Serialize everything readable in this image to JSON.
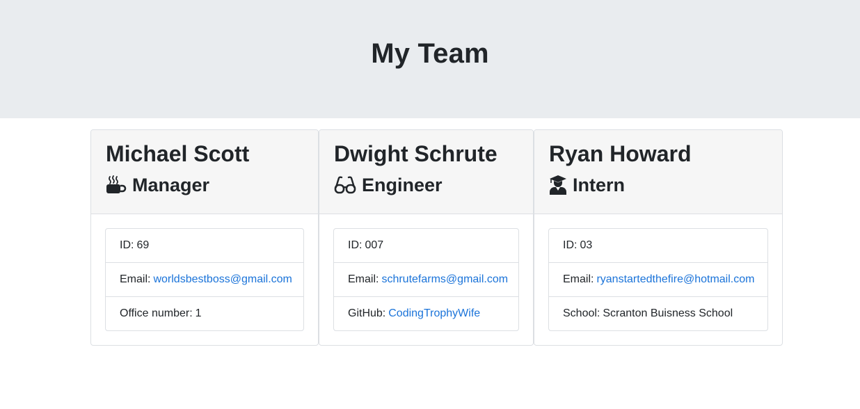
{
  "header": {
    "title": "My Team"
  },
  "employees": [
    {
      "name": "Michael Scott",
      "role": "Manager",
      "role_icon": "coffee-mug-icon",
      "id_label": "ID:",
      "id": "69",
      "email_label": "Email:",
      "email": "worldsbestboss@gmail.com",
      "extra_label": "Office number:",
      "extra_value": "1"
    },
    {
      "name": "Dwight Schrute",
      "role": "Engineer",
      "role_icon": "glasses-icon",
      "id_label": "ID:",
      "id": "007",
      "email_label": "Email:",
      "email": "schrutefarms@gmail.com",
      "extra_label": "GitHub:",
      "extra_value": "CodingTrophyWife"
    },
    {
      "name": "Ryan Howard",
      "role": "Intern",
      "role_icon": "graduate-icon",
      "id_label": "ID:",
      "id": "03",
      "email_label": "Email:",
      "email": "ryanstartedthefire@hotmail.com",
      "extra_label": "School:",
      "extra_value": "Scranton Buisness School"
    }
  ],
  "colors": {
    "header_bg": "#e9ecef",
    "card_header_bg": "#f6f6f6",
    "link": "#1a73d9",
    "text": "#212529",
    "border": "#dcdfe3"
  }
}
